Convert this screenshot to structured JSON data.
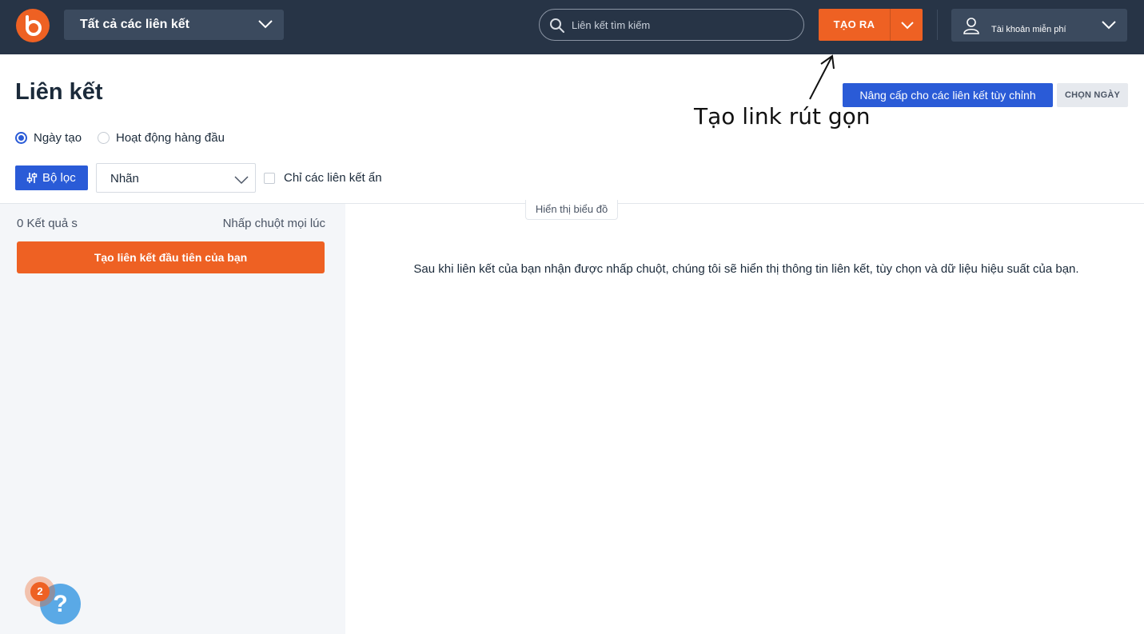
{
  "header": {
    "logo_icon": "bitly-logo-icon",
    "link_filter_label": "Tất cả các liên kết",
    "search": {
      "placeholder": "Liên kết tìm kiếm"
    },
    "create_label": "TẠO RA",
    "account_label": "Tài khoản miễn phí"
  },
  "page": {
    "title": "Liên kết",
    "upgrade_label": "Nâng cấp cho các liên kết tùy chỉnh",
    "date_label": "CHỌN NGÀY",
    "annotation": "Tạo link rút gọn"
  },
  "sort": {
    "options": [
      {
        "label": "Ngày tạo",
        "selected": true
      },
      {
        "label": "Hoạt động hàng đầu",
        "selected": false
      }
    ]
  },
  "filters": {
    "filter_label": "Bộ lọc",
    "tag_select_value": "Nhãn",
    "hidden_only_label": "Chỉ các liên kết ẩn",
    "hidden_only_checked": false
  },
  "list": {
    "results_count": "0 Kết quả s",
    "click_range": "Nhấp chuột mọi lúc",
    "first_link_label": "Tạo liên kết đầu tiên của bạn"
  },
  "detail": {
    "chart_toggle": "Hiển thị biểu đồ",
    "empty_message": "Sau khi liên kết của bạn nhận được nhấp chuột, chúng tôi sẽ hiển thị thông tin liên kết, tùy chọn và dữ liệu hiệu suất của bạn."
  },
  "help": {
    "icon": "question-icon",
    "glyph": "?",
    "badge_count": "2"
  },
  "colors": {
    "topbar": "#273446",
    "accent_orange": "#ee6123",
    "accent_blue": "#2a5bd7"
  }
}
